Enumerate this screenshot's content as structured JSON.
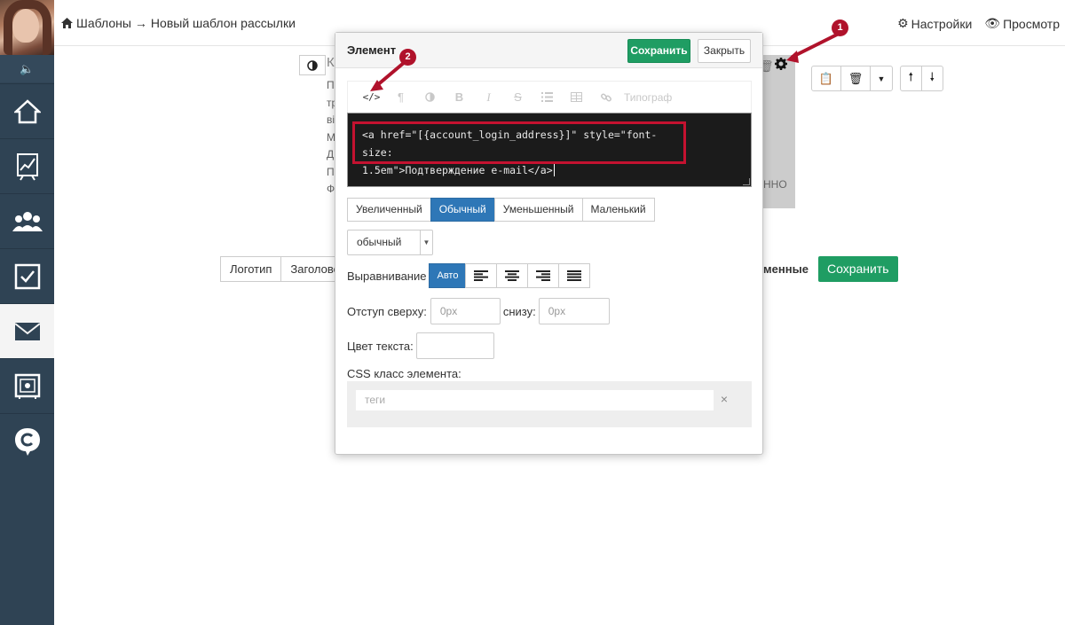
{
  "breadcrumb": {
    "templates": "Шаблоны",
    "separator": "→",
    "current": "Новый шаблон рассылки"
  },
  "topbar": {
    "settings": "Настройки",
    "preview": "Просмотр"
  },
  "sidebar": {
    "items": [
      {
        "icon": "home-icon"
      },
      {
        "icon": "chart-icon"
      },
      {
        "icon": "users-icon"
      },
      {
        "icon": "checkbox-icon"
      },
      {
        "icon": "mail-icon",
        "active": true
      },
      {
        "icon": "safe-icon"
      },
      {
        "icon": "chat-logo-icon"
      }
    ]
  },
  "background": {
    "k_letter": "К",
    "letters": [
      "П",
      "тр",
      "ві",
      "М",
      "Д",
      "П",
      "Ф"
    ],
    "nno": "ННО",
    "tabs": [
      "Логотип",
      "Заголово"
    ],
    "right_label": "еменные",
    "save": "Сохранить"
  },
  "modal": {
    "title": "Элемент",
    "save": "Сохранить",
    "close": "Закрыть",
    "toolbar": {
      "code": "</>",
      "paragraph": "¶",
      "bold": "B",
      "italic": "I",
      "strike": "S",
      "typograph": "Типограф"
    },
    "code_line1": "<a href=\"[{account_login_address}]\" style=\"font-size:",
    "code_line2": "1.5em\">Подтверждение e-mail</a>",
    "sizes": [
      "Увеличенный",
      "Обычный",
      "Уменьшенный",
      "Маленький"
    ],
    "active_size": "Обычный",
    "font_weight": "обычный",
    "align_label": "Выравнивание",
    "align_auto": "Авто",
    "pad_top_label": "Отступ сверху:",
    "pad_top_placeholder": "0px",
    "pad_bottom_label": "снизу:",
    "pad_bottom_placeholder": "0px",
    "color_label": "Цвет текста:",
    "css_label": "CSS класс элемента:",
    "tags_placeholder": "теги",
    "tags_clear": "×"
  },
  "markers": {
    "one": "1",
    "two": "2"
  },
  "colors": {
    "sidebar": "#2f4354",
    "green": "#1f9d63",
    "blue": "#2e77b7",
    "annotation": "#b0122b"
  }
}
